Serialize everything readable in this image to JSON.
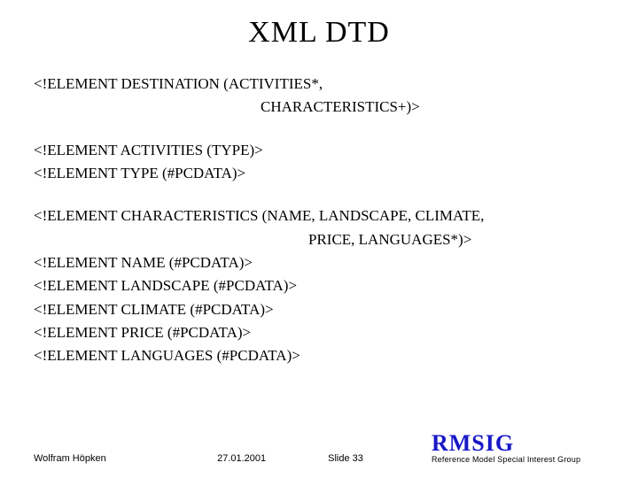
{
  "title": "XML DTD",
  "lines": {
    "l1": "<!ELEMENT DESTINATION (ACTIVITIES*,",
    "l2": "CHARACTERISTICS+)>",
    "l3": "<!ELEMENT ACTIVITIES (TYPE)>",
    "l4": "<!ELEMENT TYPE (#PCDATA)>",
    "l5": "<!ELEMENT CHARACTERISTICS (NAME, LANDSCAPE, CLIMATE,",
    "l6": "PRICE, LANGUAGES*)>",
    "l7": "<!ELEMENT NAME (#PCDATA)>",
    "l8": "<!ELEMENT LANDSCAPE (#PCDATA)>",
    "l9": "<!ELEMENT CLIMATE (#PCDATA)>",
    "l10": "<!ELEMENT PRICE (#PCDATA)>",
    "l11": "<!ELEMENT LANGUAGES (#PCDATA)>"
  },
  "footer": {
    "author": "Wolfram Höpken",
    "date": "27.01.2001",
    "slide": "Slide 33",
    "logo": "RMSIG",
    "logo_sub": "Reference Model Special Interest Group"
  }
}
